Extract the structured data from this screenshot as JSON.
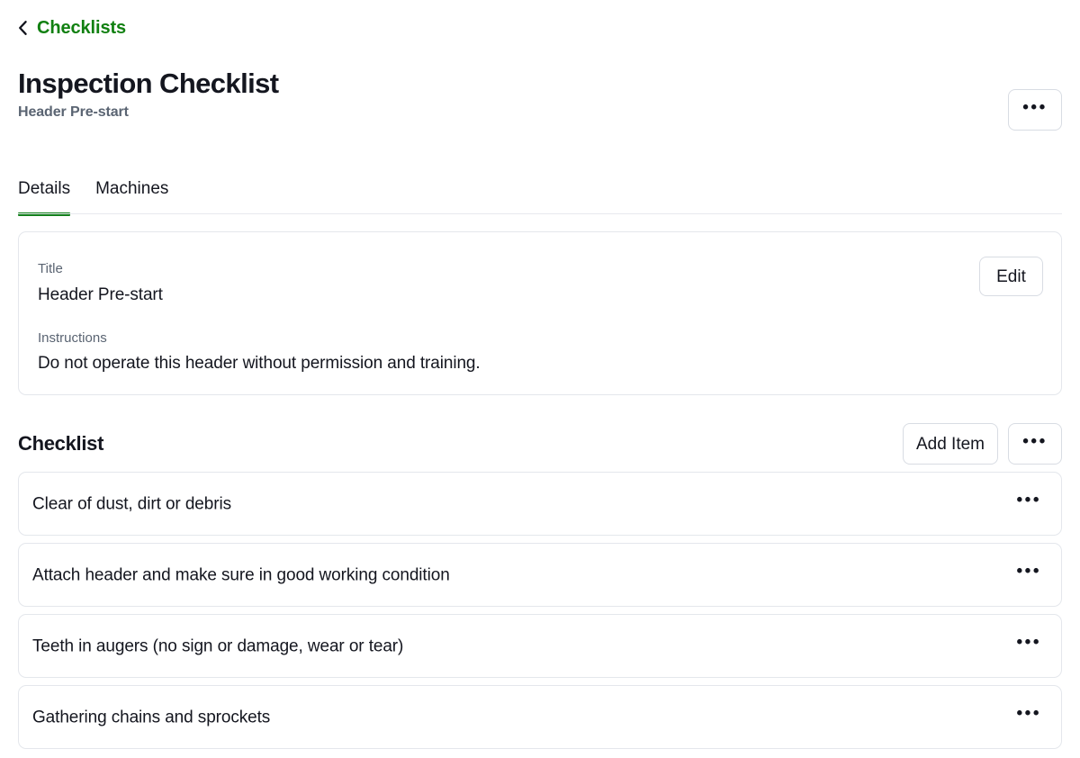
{
  "back": {
    "label": "Checklists",
    "icon": "chevron-left-icon",
    "color": "#118011"
  },
  "header": {
    "title": "Inspection Checklist",
    "subtitle": "Header Pre-start",
    "more_label": "•••"
  },
  "tabs": [
    {
      "label": "Details",
      "active": true
    },
    {
      "label": "Machines",
      "active": false
    }
  ],
  "details_card": {
    "title_label": "Title",
    "title_value": "Header Pre-start",
    "instructions_label": "Instructions",
    "instructions_value": "Do not operate this header without permission and training.",
    "edit_label": "Edit"
  },
  "checklist_section": {
    "heading": "Checklist",
    "add_item_label": "Add Item",
    "more_label": "•••"
  },
  "checklist_items": [
    {
      "label": "Clear of dust, dirt or debris",
      "more_label": "•••"
    },
    {
      "label": "Attach header and make sure in good working condition",
      "more_label": "•••"
    },
    {
      "label": "Teeth in augers (no sign or damage, wear or tear)",
      "more_label": "•••"
    },
    {
      "label": "Gathering chains and sprockets",
      "more_label": "•••"
    }
  ],
  "theme": {
    "accent_green": "#12801a",
    "link_green": "#118011",
    "text_primary": "#14161f",
    "text_muted": "#5a6472",
    "border": "#e4e7ec",
    "background": "#ffffff"
  }
}
